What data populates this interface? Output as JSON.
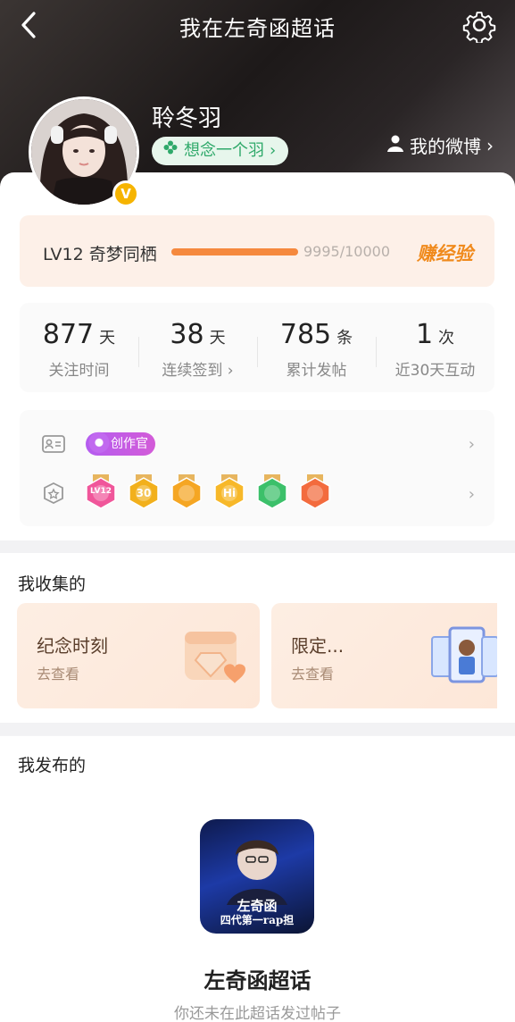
{
  "header": {
    "title": "我在左奇函超话",
    "back_icon": "back-arrow-icon",
    "settings_icon": "gear-icon"
  },
  "profile": {
    "username": "聆冬羽",
    "tag": "想念一个羽",
    "tag_chevron": "›",
    "my_weibo": "我的微博",
    "my_weibo_chevron": "›",
    "vip_mark": "V"
  },
  "level": {
    "label": "LV12 奇梦同栖",
    "progress_text": "9995/10000",
    "progress_fraction": 0.9995,
    "earn_label": "赚经验",
    "accent_color": "#f5893e"
  },
  "stats": [
    {
      "number": "877",
      "unit": "天",
      "label": "关注时间"
    },
    {
      "number": "38",
      "unit": "天",
      "label": "连续签到 ›"
    },
    {
      "number": "785",
      "unit": "条",
      "label": "累计发帖"
    },
    {
      "number": "1",
      "unit": "次",
      "label": "近30天互动"
    }
  ],
  "badges": {
    "creator_label": "创作官",
    "row_chevron": "›",
    "medals": [
      {
        "icon": "lv12-medal-icon",
        "text": "LV12",
        "color": "#f0569a"
      },
      {
        "icon": "30-days-medal-icon",
        "text": "30",
        "color": "#f2b01c"
      },
      {
        "icon": "crown-medal-icon",
        "text": "",
        "color": "#f5a623"
      },
      {
        "icon": "hi-medal-icon",
        "text": "Hi",
        "color": "#f7b829"
      },
      {
        "icon": "hand-medal-icon",
        "text": "",
        "color": "#3cc06a"
      },
      {
        "icon": "rock-hand-medal-icon",
        "text": "",
        "color": "#f36b3e"
      }
    ]
  },
  "collect": {
    "section_title": "我收集的",
    "cards": [
      {
        "title": "纪念时刻",
        "sub": "去查看"
      },
      {
        "title": "限定...",
        "sub": "去查看"
      }
    ]
  },
  "posts": {
    "section_title": "我发布的",
    "cover_line1": "左奇函",
    "cover_line2": "四代第一rap担",
    "topic_name": "左奇函超话",
    "empty_text": "你还未在此超话发过帖子"
  }
}
